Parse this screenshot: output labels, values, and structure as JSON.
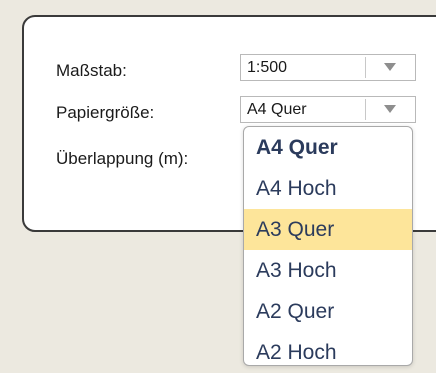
{
  "form": {
    "scale": {
      "label": "Maßstab:",
      "value": "1:500"
    },
    "paper_size": {
      "label": "Papiergröße:",
      "value": "A4 Quer"
    },
    "overlap": {
      "label": "Überlappung (m):"
    }
  },
  "dropdown": {
    "options": [
      {
        "label": "A4 Quer",
        "selected": true
      },
      {
        "label": "A4 Hoch"
      },
      {
        "label": "A3 Quer",
        "highlighted": true
      },
      {
        "label": "A3 Hoch"
      },
      {
        "label": "A2 Quer"
      },
      {
        "label": "A2 Hoch"
      }
    ]
  },
  "colors": {
    "highlight": "#fde59a",
    "option_text": "#2b3b5c",
    "background": "#ece9e0"
  }
}
